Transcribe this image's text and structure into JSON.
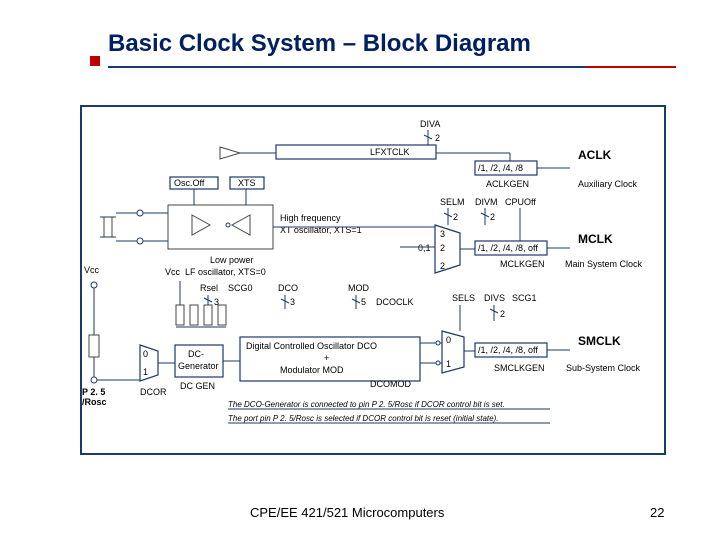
{
  "title": "Basic Clock System – Block Diagram",
  "footer": {
    "course": "CPE/EE 421/521 Microcomputers",
    "page": "22"
  },
  "labels": {
    "diva": "DIVA",
    "diva_n": "2",
    "lfxtclk": "LFXTCLK",
    "aclk_div": "/1, /2, /4, /8",
    "aclk": "ACLK",
    "aclkgen": "ACLKGEN",
    "aux_clk": "Auxiliary Clock",
    "oscoff": "Osc.Off",
    "xts": "XTS",
    "selm": "SELM",
    "divm": "DIVM",
    "cpuoff": "CPUOff",
    "selm_n": "2",
    "divm_n": "2",
    "mux3": "3",
    "mux2a": "2",
    "mux01": "0,1",
    "hf": "High frequency",
    "xt_osc": "XT oscillator, XTS=1",
    "lowp": "Low power",
    "lf_osc": "LF oscillator, XTS=0",
    "mclk_div": "/1, /2, /4, /8, off",
    "mclk": "MCLK",
    "mclkgen": "MCLKGEN",
    "main_clk": "Main System Clock",
    "vcc": "Vcc",
    "rsel": "Rsel",
    "scg0": "SCG0",
    "rsel_n": "3",
    "dco": "DCO",
    "dco_n": "3",
    "mod": "MOD",
    "mod_n": "5",
    "dcoclk": "DCOCLK",
    "sels": "SELS",
    "divs": "DIVS",
    "scg1": "SCG1",
    "divs_n": "2",
    "sel0": "0",
    "sel1": "1",
    "smclk_div": "/1, /2, /4, /8, off",
    "smclk": "SMCLK",
    "smclkgen": "SMCLKGEN",
    "sub_clk": "Sub-System Clock",
    "dcgen_top": "DC-",
    "dcgen_bot": "Generator",
    "dcor": "DCOR",
    "dcgen_lbl": "DC GEN",
    "dco_box_a": "Digital Controlled Oscillator DCO",
    "dco_box_b": "+",
    "dco_box_c": "Modulator  MOD",
    "dcomod": "DCOMOD",
    "p25": "P 2. 5",
    "rosc": "/Rosc",
    "note1": "The DCO-Generator is connected to pin P 2. 5/Rosc if DCOR control bit is set.",
    "note2": "The port pin P 2. 5/Rosc is selected if DCOR control bit is reset (initial state)."
  }
}
